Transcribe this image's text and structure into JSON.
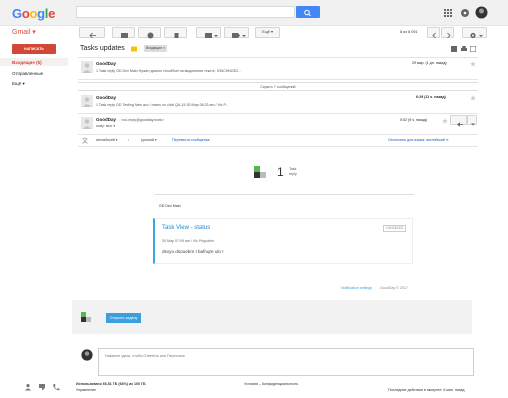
{
  "logo": {
    "text": "Google",
    "colors": [
      "#4285f4",
      "#ea4335",
      "#fbbc05",
      "#4285f4",
      "#34a853",
      "#ea4335"
    ]
  },
  "app_label": "Gmail ▾",
  "compose_label": "НАПИСАТЬ",
  "nav": [
    {
      "label": "Входящие (5)"
    },
    {
      "label": "Отправленные"
    },
    {
      "label": "Ещё ▾"
    }
  ],
  "toolbar": {
    "more_label": "Ещё ▾",
    "pager": "8 из 8 091"
  },
  "thread": {
    "subject": "Tasks updates",
    "label": "Входящие ×",
    "messages": [
      {
        "sender": "GoodDay",
        "time": "29 мар. (1 дн. назад)",
        "snippet": "1 Task reply GD Dev Main Нужен диалог chooElsel на выделения тексте, IONCHNGE2..."
      },
      {
        "sender": "GoodDay",
        "time": "6:29 (11 ч. назад)",
        "snippet": "1 Task reply GD Testing New acc / mweu no click QA-15 30 Мар 06:23 am / Vic P..."
      }
    ],
    "collapsed": "Скрыто 7 сообщений",
    "open": {
      "sender": "GoodDay",
      "sender_email": "<no-reply@goodday.work>",
      "to": "кому: мне ▾",
      "time": "0:02 (9 ч. назад)"
    },
    "translate": {
      "from": "английский ▾",
      "arrow": "›",
      "to": "русский ▾",
      "action": "Перевести сообщение",
      "disable": "Отключить для языка: английский ✕"
    }
  },
  "email": {
    "count": "1",
    "count_label1": "Task",
    "count_label2": "reply",
    "workspace": "GD Dev Main",
    "task_title": "Task View - status",
    "status_btn": "CANCELED",
    "meta": "30 Мар 07:09 am  /  Vic Prigozhin",
    "body": "dsvyu dsouebm I bafnqre ulo I",
    "footer_link": "Notification settings",
    "footer_copy": "GoodDay © 2017",
    "button": "Открыть задачу"
  },
  "reply_prompt": "Нажмите здесь, чтобы Ответить или Переслать",
  "storage": {
    "used": "Использовано 66,51 ГБ (66%) из 100 ГБ",
    "manage": "Управление"
  },
  "terms": "Условия – Конфиденциальность",
  "activity": "Последние действия в аккаунте: 6 мин. назад"
}
